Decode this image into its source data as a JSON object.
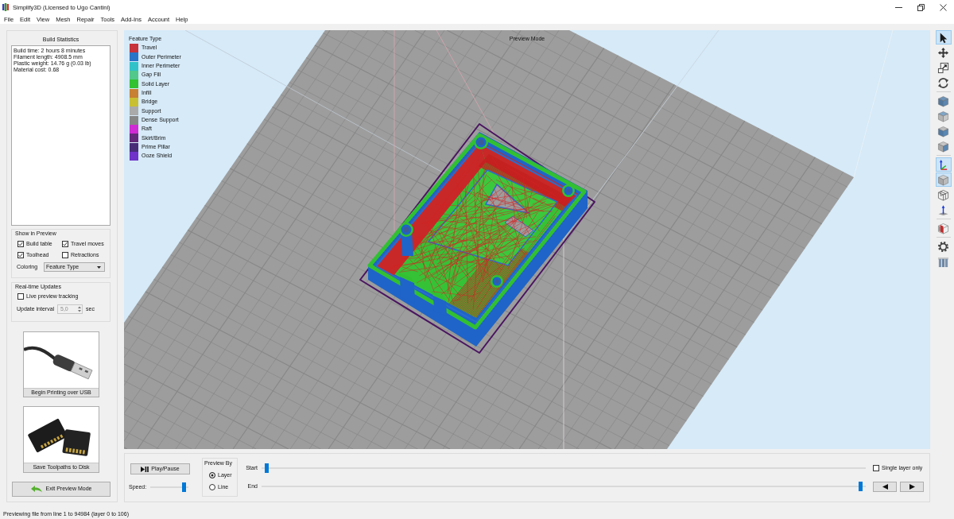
{
  "window": {
    "title": "Simplify3D (Licensed to Ugo Cantini)"
  },
  "menu": [
    "File",
    "Edit",
    "View",
    "Mesh",
    "Repair",
    "Tools",
    "Add-Ins",
    "Account",
    "Help"
  ],
  "build_statistics": {
    "title": "Build Statistics",
    "lines": [
      "Build time: 2 hours 8 minutes",
      "Filament length: 4908.5 mm",
      "Plastic weight: 14.76 g (0.03 lb)",
      "Material cost: 0.68"
    ]
  },
  "show_in_preview": {
    "title": "Show in Preview",
    "options": [
      {
        "label": "Build table",
        "checked": true
      },
      {
        "label": "Travel moves",
        "checked": true
      },
      {
        "label": "Toolhead",
        "checked": true
      },
      {
        "label": "Retractions",
        "checked": false
      }
    ],
    "coloring": {
      "label": "Coloring",
      "value": "Feature Type"
    }
  },
  "realtime_updates": {
    "title": "Real-time Updates",
    "live_tracking": {
      "label": "Live preview tracking",
      "checked": false
    },
    "update_interval": {
      "label": "Update interval",
      "value": "5,0",
      "unit": "sec",
      "disabled": true
    }
  },
  "output_buttons": [
    {
      "kind": "usb",
      "label": "Begin Printing over USB"
    },
    {
      "kind": "sd",
      "label": "Save Toolpaths to Disk"
    }
  ],
  "exit_button": {
    "label": "Exit Preview Mode"
  },
  "viewport": {
    "mode_label": "Preview Mode",
    "legend": {
      "title": "Feature Type",
      "items": [
        {
          "label": "Travel",
          "color": "#c8323a"
        },
        {
          "label": "Outer Perimeter",
          "color": "#2a74c8"
        },
        {
          "label": "Inner Perimeter",
          "color": "#30c2c8"
        },
        {
          "label": "Gap Fill",
          "color": "#52c88a"
        },
        {
          "label": "Solid Layer",
          "color": "#32c232"
        },
        {
          "label": "Infill",
          "color": "#c88032"
        },
        {
          "label": "Bridge",
          "color": "#c8c032"
        },
        {
          "label": "Support",
          "color": "#aaaaaa"
        },
        {
          "label": "Dense Support",
          "color": "#868686"
        },
        {
          "label": "Raft",
          "color": "#d02ad4"
        },
        {
          "label": "Skirt/Brim",
          "color": "#64287a"
        },
        {
          "label": "Prime Pillar",
          "color": "#482c78"
        },
        {
          "label": "Ooze Shield",
          "color": "#7032c8"
        }
      ]
    }
  },
  "toolbar": {
    "groups": [
      {
        "tools": [
          {
            "kind": "pointer",
            "selected": true
          },
          {
            "kind": "move",
            "selected": false
          },
          {
            "kind": "scale",
            "selected": false
          },
          {
            "kind": "rotate",
            "selected": false
          }
        ]
      },
      {
        "tools": [
          {
            "kind": "topview",
            "selected": false
          },
          {
            "kind": "isoview",
            "selected": false
          },
          {
            "kind": "frontview",
            "selected": false
          },
          {
            "kind": "sideview",
            "selected": false
          }
        ]
      },
      {
        "tools": [
          {
            "kind": "axes",
            "selected": true
          },
          {
            "kind": "solid",
            "selected": true
          },
          {
            "kind": "wireframe",
            "selected": false
          },
          {
            "kind": "plate",
            "selected": false
          }
        ]
      },
      {
        "tools": [
          {
            "kind": "section",
            "selected": false
          }
        ]
      },
      {
        "tools": [
          {
            "kind": "gear",
            "selected": false
          },
          {
            "kind": "bars",
            "selected": false
          }
        ]
      }
    ]
  },
  "playback": {
    "play_pause": {
      "label": "Play/Pause"
    },
    "speed": {
      "label": "Speed:",
      "level": 0.93
    },
    "preview_by": {
      "title": "Preview By",
      "options": [
        {
          "label": "Layer",
          "selected": true
        },
        {
          "label": "Line",
          "selected": false
        }
      ]
    },
    "start": {
      "label": "Start",
      "level": 0.005
    },
    "end": {
      "label": "End",
      "level": 0.995
    },
    "single_layer": {
      "label": "Single layer only",
      "checked": false
    }
  },
  "status_bar": "Previewing file from line 1 to 94984 (layer 0 to 106)"
}
